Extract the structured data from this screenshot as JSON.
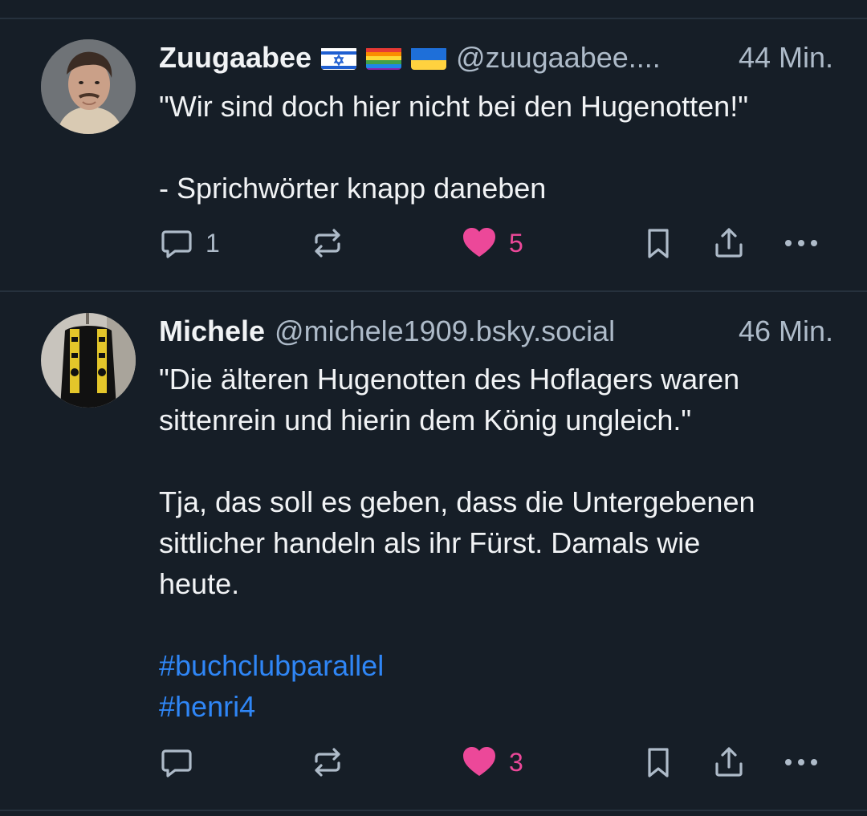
{
  "posts": [
    {
      "name": "Zuugaabee",
      "flags": [
        "israel-flag",
        "rainbow-flag",
        "ukraine-flag"
      ],
      "handle": "@zuugaabee....",
      "time": "44 Min.",
      "paragraphs": [
        "\"Wir sind doch hier nicht bei den Hugenotten!\"",
        "- Sprichwörter knapp daneben"
      ],
      "reply_count": "1",
      "like_count": "5"
    },
    {
      "name": "Michele",
      "handle": "@michele1909.bsky.social",
      "time": "46 Min.",
      "lines_p1": [
        "\"Die älteren Hugenotten des Hoflagers waren",
        "sittenrein und hierin dem König ungleich.\""
      ],
      "lines_p2": [
        "Tja, das soll es geben, dass die Untergebenen",
        "sittlicher handeln als ihr Fürst. Damals wie",
        "heute."
      ],
      "hashtags": [
        "#buchclubparallel",
        "#henri4"
      ],
      "reply_count": "",
      "like_count": "3"
    }
  ],
  "colors": {
    "background": "#161e27",
    "divider": "#26313d",
    "text": "#f1f3f5",
    "muted": "#aebbc9",
    "like": "#ec4899",
    "hashtag": "#2f86f6"
  }
}
